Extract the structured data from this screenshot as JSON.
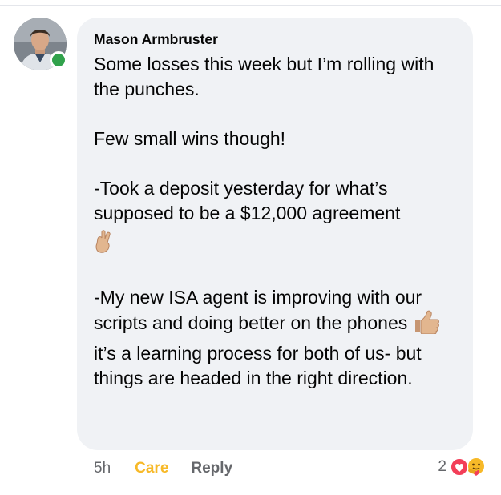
{
  "comment": {
    "author": "Mason Armbruster",
    "lines": [
      "Some losses this week but I’m rolling with the punches.",
      "Few small wins though!",
      "-Took a deposit yesterday for what’s supposed to be a $12,000 agreement",
      "-My new ISA agent is improving with our scripts and doing better on the phones",
      "it’s a learning process for both of us- but things are headed in the right direction."
    ],
    "emoji": {
      "crossed_fingers": "🤞",
      "thumbs_up": "👍"
    }
  },
  "actions": {
    "time": "5h",
    "care_label": "Care",
    "reply_label": "Reply"
  },
  "reactions": {
    "count": "2",
    "types": [
      "love-icon",
      "care-icon"
    ]
  },
  "colors": {
    "bubble": "#f0f2f5",
    "online": "#31a24c",
    "care": "#f7b928",
    "love": "#f33e58",
    "muted": "#65676b"
  }
}
